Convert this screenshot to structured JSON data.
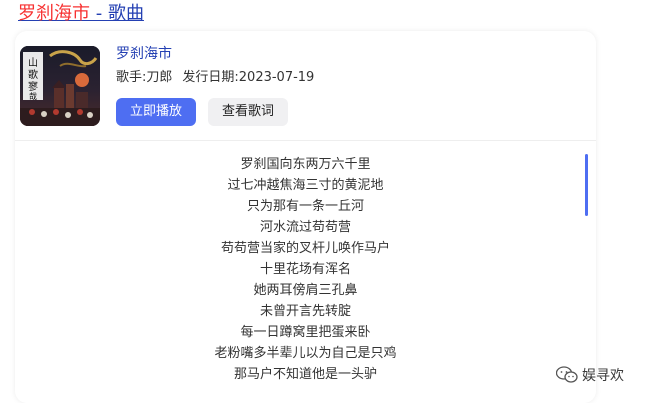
{
  "header": {
    "title_highlight": "罗刹海市",
    "title_rest": " - 歌曲"
  },
  "song": {
    "cover_title": "山歌寥哉",
    "name": "罗刹海市",
    "singer_text": "歌手:刀郎",
    "release_text": "发行日期:2023-07-19"
  },
  "actions": {
    "play_label": "立即播放",
    "lyrics_label": "查看歌词"
  },
  "lyrics": [
    "罗刹国向东两万六千里",
    "过七冲越焦海三寸的黄泥地",
    "只为那有一条一丘河",
    "河水流过苟苟营",
    "苟苟营当家的叉杆儿唤作马户",
    "十里花场有浑名",
    "她两耳傍肩三孔鼻",
    "未曾开言先转腚",
    "每一日蹲窝里把蛋来卧",
    "老粉嘴多半辈儿以为自己是只鸡",
    "那马户不知道他是一头驴"
  ],
  "watermark": {
    "text": "娱寻欢"
  },
  "colors": {
    "link": "#2440b3",
    "highlight": "#f73131",
    "primary_button": "#4e6ef2",
    "secondary_button": "#f0f0f2"
  }
}
